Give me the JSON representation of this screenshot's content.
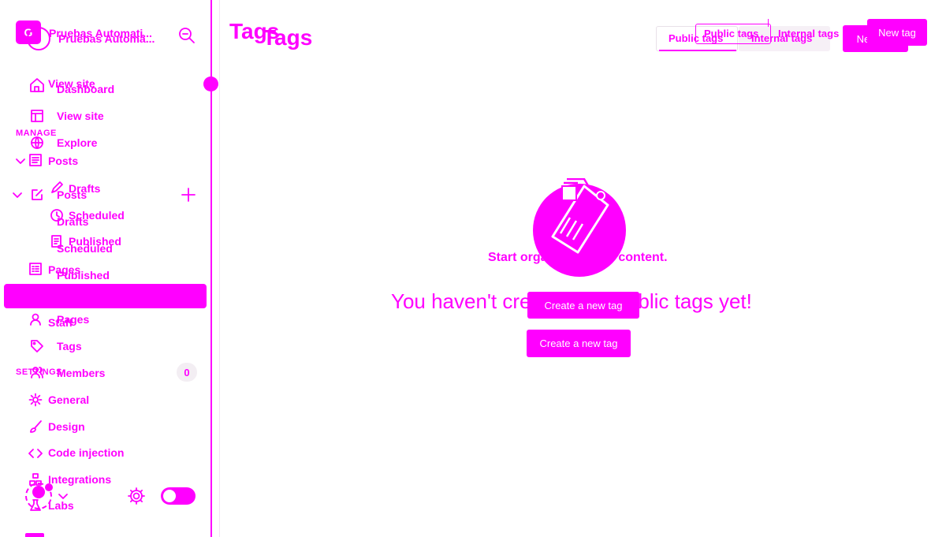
{
  "site": {
    "name_a": "Pruebas Automati...",
    "name_b": "Pruebas Automá..."
  },
  "nav_a": {
    "view_site": "View site",
    "manage_label": "MANAGE",
    "posts": "Posts",
    "drafts": "Drafts",
    "scheduled": "Scheduled",
    "published": "Published",
    "pages": "Pages",
    "staff": "Staff",
    "settings_label": "SETTINGS",
    "general": "General",
    "design": "Design",
    "code_injection": "Code injection",
    "integrations": "Integrations",
    "labs": "Labs"
  },
  "nav_b": {
    "dashboard": "Dashboard",
    "view_site": "View site",
    "explore": "Explore",
    "posts": "Posts",
    "drafts": "Drafts",
    "scheduled": "Scheduled",
    "published": "Published",
    "pages": "Pages",
    "tags": "Tags",
    "members": "Members",
    "members_count": "0"
  },
  "header": {
    "title_a": "Tags",
    "title_b": "Tags",
    "public_tab_a": "Public tags",
    "internal_tab_a": "Internal tags",
    "new_tag_a": "New tag",
    "public_tab_b": "Public tags",
    "internal_tab_b": "Internal tags",
    "new_tag_b": "New tag"
  },
  "empty_state": {
    "bold_line": "Start organizing your content.",
    "big_line": "You haven't created any public tags yet!",
    "create_a": "Create a new tag",
    "create_b": "Create a new tag"
  },
  "colors": {
    "accent": "#ff00ff",
    "background": "#ffffff"
  }
}
